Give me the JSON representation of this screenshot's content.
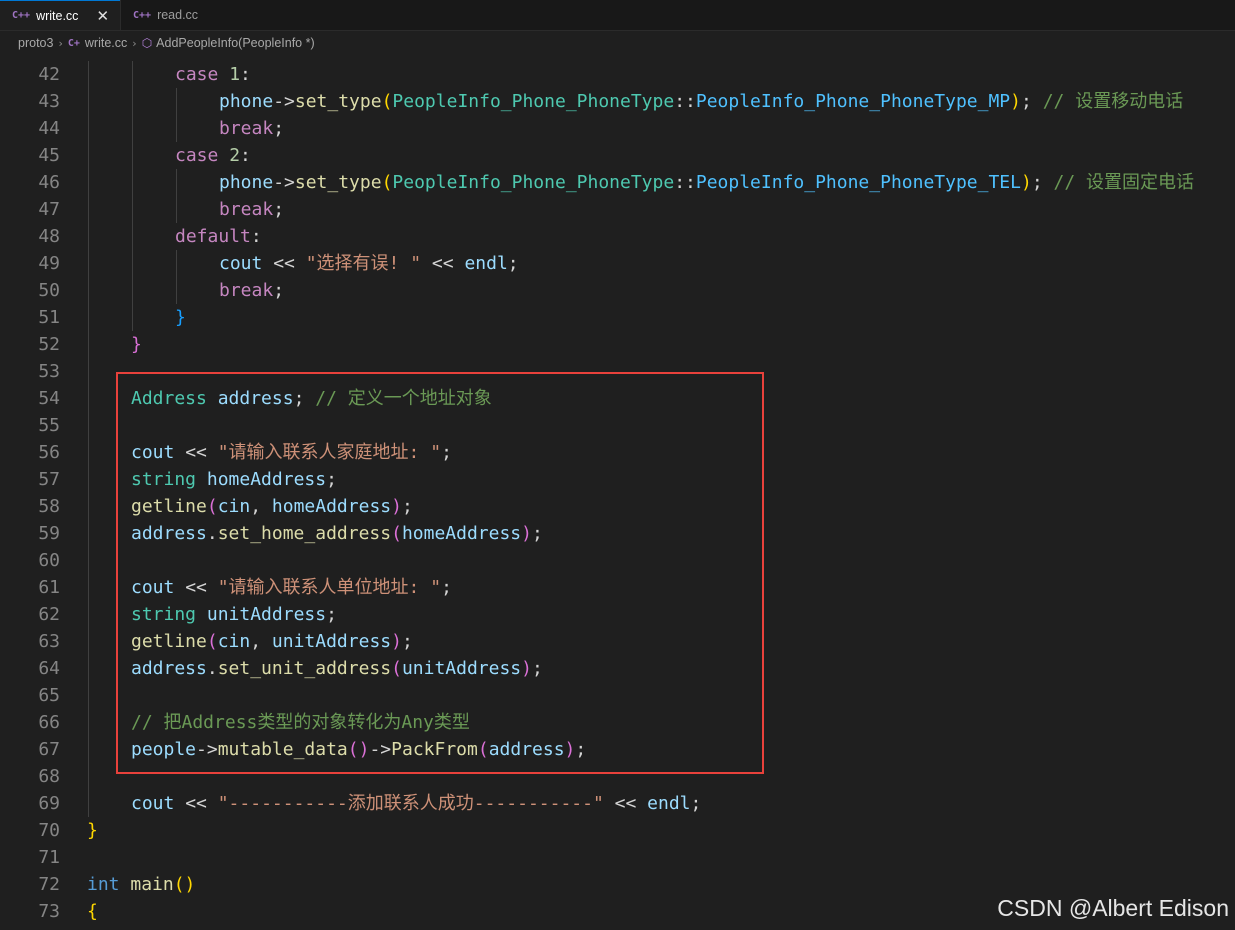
{
  "tabs": [
    {
      "icon": "C++",
      "label": "write.cc",
      "active": true
    },
    {
      "icon": "C++",
      "label": "read.cc",
      "active": false
    }
  ],
  "breadcrumb": {
    "folder": "proto3",
    "file": "write.cc",
    "symbol": "AddPeopleInfo(PeopleInfo *)"
  },
  "watermark": "CSDN @Albert Edison",
  "code_lines": [
    {
      "n": "42",
      "segments": [
        [
          "kw",
          "case"
        ],
        [
          "",
          " "
        ],
        [
          "num",
          "1"
        ],
        [
          "",
          ":"
        ]
      ]
    },
    {
      "n": "43",
      "segments": [
        [
          "var",
          "phone"
        ],
        [
          "",
          "->"
        ],
        [
          "fn",
          "set_type"
        ],
        [
          "b1",
          "("
        ],
        [
          "ty",
          "PeopleInfo_Phone_PhoneType"
        ],
        [
          "",
          "::"
        ],
        [
          "en",
          "PeopleInfo_Phone_PhoneType_MP"
        ],
        [
          "b1",
          ")"
        ],
        [
          "",
          ";"
        ],
        [
          "",
          " "
        ],
        [
          "cm",
          "// 设置移动电话"
        ]
      ]
    },
    {
      "n": "44",
      "segments": [
        [
          "kw",
          "break"
        ],
        [
          "",
          ";"
        ]
      ]
    },
    {
      "n": "45",
      "segments": [
        [
          "kw",
          "case"
        ],
        [
          "",
          " "
        ],
        [
          "num",
          "2"
        ],
        [
          "",
          ":"
        ]
      ]
    },
    {
      "n": "46",
      "segments": [
        [
          "var",
          "phone"
        ],
        [
          "",
          "->"
        ],
        [
          "fn",
          "set_type"
        ],
        [
          "b1",
          "("
        ],
        [
          "ty",
          "PeopleInfo_Phone_PhoneType"
        ],
        [
          "",
          "::"
        ],
        [
          "en",
          "PeopleInfo_Phone_PhoneType_TEL"
        ],
        [
          "b1",
          ")"
        ],
        [
          "",
          ";"
        ],
        [
          "",
          " "
        ],
        [
          "cm",
          "// 设置固定电话"
        ]
      ]
    },
    {
      "n": "47",
      "segments": [
        [
          "kw",
          "break"
        ],
        [
          "",
          ";"
        ]
      ]
    },
    {
      "n": "48",
      "segments": [
        [
          "kw",
          "default"
        ],
        [
          "",
          ":"
        ]
      ]
    },
    {
      "n": "49",
      "segments": [
        [
          "var",
          "cout"
        ],
        [
          "",
          " << "
        ],
        [
          "str",
          "\"选择有误! \""
        ],
        [
          "",
          " << "
        ],
        [
          "var",
          "endl"
        ],
        [
          "",
          ";"
        ]
      ]
    },
    {
      "n": "50",
      "segments": [
        [
          "kw",
          "break"
        ],
        [
          "",
          ";"
        ]
      ]
    },
    {
      "n": "51",
      "segments": [
        [
          "b3",
          "}"
        ]
      ]
    },
    {
      "n": "52",
      "segments": [
        [
          "b2",
          "}"
        ]
      ]
    },
    {
      "n": "53",
      "segments": []
    },
    {
      "n": "54",
      "segments": [
        [
          "ty",
          "Address"
        ],
        [
          "",
          " "
        ],
        [
          "var",
          "address"
        ],
        [
          "",
          ";"
        ],
        [
          "",
          " "
        ],
        [
          "cm",
          "// 定义一个地址对象"
        ]
      ]
    },
    {
      "n": "55",
      "segments": []
    },
    {
      "n": "56",
      "segments": [
        [
          "var",
          "cout"
        ],
        [
          "",
          " << "
        ],
        [
          "str",
          "\"请输入联系人家庭地址: \""
        ],
        [
          "",
          ";"
        ]
      ]
    },
    {
      "n": "57",
      "segments": [
        [
          "ty",
          "string"
        ],
        [
          "",
          " "
        ],
        [
          "var",
          "homeAddress"
        ],
        [
          "",
          ";"
        ]
      ]
    },
    {
      "n": "58",
      "segments": [
        [
          "fn",
          "getline"
        ],
        [
          "b2",
          "("
        ],
        [
          "var",
          "cin"
        ],
        [
          "",
          ", "
        ],
        [
          "var",
          "homeAddress"
        ],
        [
          "b2",
          ")"
        ],
        [
          "",
          ";"
        ]
      ]
    },
    {
      "n": "59",
      "segments": [
        [
          "var",
          "address"
        ],
        [
          "",
          "."
        ],
        [
          "fn",
          "set_home_address"
        ],
        [
          "b2",
          "("
        ],
        [
          "var",
          "homeAddress"
        ],
        [
          "b2",
          ")"
        ],
        [
          "",
          ";"
        ]
      ]
    },
    {
      "n": "60",
      "segments": []
    },
    {
      "n": "61",
      "segments": [
        [
          "var",
          "cout"
        ],
        [
          "",
          " << "
        ],
        [
          "str",
          "\"请输入联系人单位地址: \""
        ],
        [
          "",
          ";"
        ]
      ]
    },
    {
      "n": "62",
      "segments": [
        [
          "ty",
          "string"
        ],
        [
          "",
          " "
        ],
        [
          "var",
          "unitAddress"
        ],
        [
          "",
          ";"
        ]
      ]
    },
    {
      "n": "63",
      "segments": [
        [
          "fn",
          "getline"
        ],
        [
          "b2",
          "("
        ],
        [
          "var",
          "cin"
        ],
        [
          "",
          ", "
        ],
        [
          "var",
          "unitAddress"
        ],
        [
          "b2",
          ")"
        ],
        [
          "",
          ";"
        ]
      ]
    },
    {
      "n": "64",
      "segments": [
        [
          "var",
          "address"
        ],
        [
          "",
          "."
        ],
        [
          "fn",
          "set_unit_address"
        ],
        [
          "b2",
          "("
        ],
        [
          "var",
          "unitAddress"
        ],
        [
          "b2",
          ")"
        ],
        [
          "",
          ";"
        ]
      ]
    },
    {
      "n": "65",
      "segments": []
    },
    {
      "n": "66",
      "segments": [
        [
          "cm",
          "// 把Address类型的对象转化为Any类型"
        ]
      ]
    },
    {
      "n": "67",
      "segments": [
        [
          "var",
          "people"
        ],
        [
          "",
          "->"
        ],
        [
          "fn",
          "mutable_data"
        ],
        [
          "b2",
          "()"
        ],
        [
          "",
          "->"
        ],
        [
          "fn",
          "PackFrom"
        ],
        [
          "b2",
          "("
        ],
        [
          "var",
          "address"
        ],
        [
          "b2",
          ")"
        ],
        [
          "",
          ";"
        ]
      ]
    },
    {
      "n": "68",
      "segments": []
    },
    {
      "n": "69",
      "segments": [
        [
          "var",
          "cout"
        ],
        [
          "",
          " << "
        ],
        [
          "str",
          "\"-----------添加联系人成功-----------\""
        ],
        [
          "",
          " << "
        ],
        [
          "var",
          "endl"
        ],
        [
          "",
          ";"
        ]
      ]
    },
    {
      "n": "70",
      "segments": [
        [
          "b1",
          "}"
        ]
      ]
    },
    {
      "n": "71",
      "segments": []
    },
    {
      "n": "72",
      "segments": [
        [
          "bl",
          "int"
        ],
        [
          "",
          " "
        ],
        [
          "fn",
          "main"
        ],
        [
          "b1",
          "()"
        ]
      ]
    },
    {
      "n": "73",
      "segments": [
        [
          "b1",
          "{"
        ]
      ]
    }
  ]
}
